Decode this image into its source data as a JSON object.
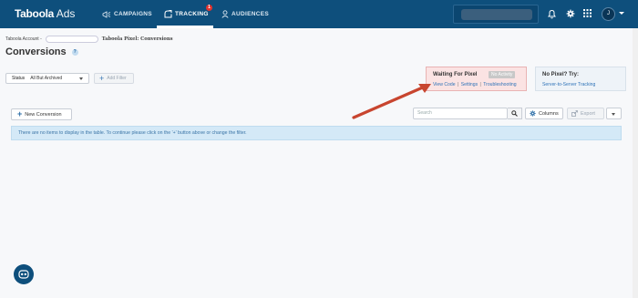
{
  "app": {
    "brand": "Taboola",
    "brand_suffix": "Ads"
  },
  "nav": {
    "campaigns": "CAMPAIGNS",
    "tracking": "TRACKING",
    "tracking_badge": "1",
    "audiences": "AUDIENCES"
  },
  "user": {
    "avatar_initial": "J"
  },
  "breadcrumb": {
    "account_label": "Taboola Account -",
    "current": "Taboola Pixel: Conversions"
  },
  "page": {
    "title": "Conversions",
    "help": "?"
  },
  "filters": {
    "status_label": "Status",
    "status_value": "All But Archived",
    "add_filter": "Add Filter"
  },
  "pixel_status": {
    "title": "Waiting For Pixel",
    "badge": "No Activity",
    "links": [
      "View Code",
      "Settings",
      "Troubleshooting"
    ],
    "separator": "|"
  },
  "no_pixel": {
    "title": "No Pixel? Try:",
    "link": "Server-to-Server Tracking"
  },
  "toolbar": {
    "new_conversion": "New Conversion",
    "search_placeholder": "Search",
    "columns": "Columns",
    "export": "Export"
  },
  "table": {
    "empty_message": "There are no items to display in the table. To continue please click on the '+' button above or change the filter."
  },
  "colors": {
    "header_bg": "#0e4f7c",
    "link": "#2f73b8",
    "pixel_box_bg": "#fbe3e3",
    "info_bg": "#d4e9f7",
    "arrow": "#c8452f"
  }
}
